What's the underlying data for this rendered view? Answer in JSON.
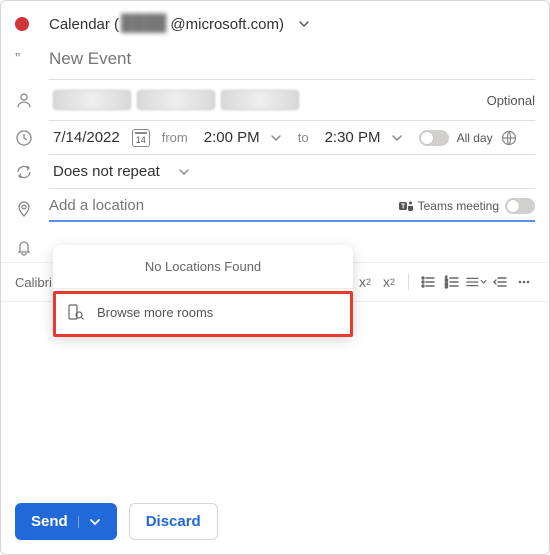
{
  "header": {
    "calendar_label_prefix": "Calendar (",
    "calendar_email_suffix": "@microsoft.com)",
    "calendar_email_hidden": "████"
  },
  "title_placeholder": "New Event",
  "optional_label": "Optional",
  "datetime": {
    "date": "7/14/2022",
    "day_num": "14",
    "from_label": "from",
    "start_time": "2:00 PM",
    "to_label": "to",
    "end_time": "2:30 PM",
    "all_day_label": "All day"
  },
  "repeat": {
    "value": "Does not repeat"
  },
  "location": {
    "placeholder": "Add a location",
    "teams_label": "Teams meeting"
  },
  "popup": {
    "empty_message": "No Locations Found",
    "browse_label": "Browse more rooms"
  },
  "toolbar": {
    "font_name": "Calibri"
  },
  "footer": {
    "send_label": "Send",
    "discard_label": "Discard"
  }
}
